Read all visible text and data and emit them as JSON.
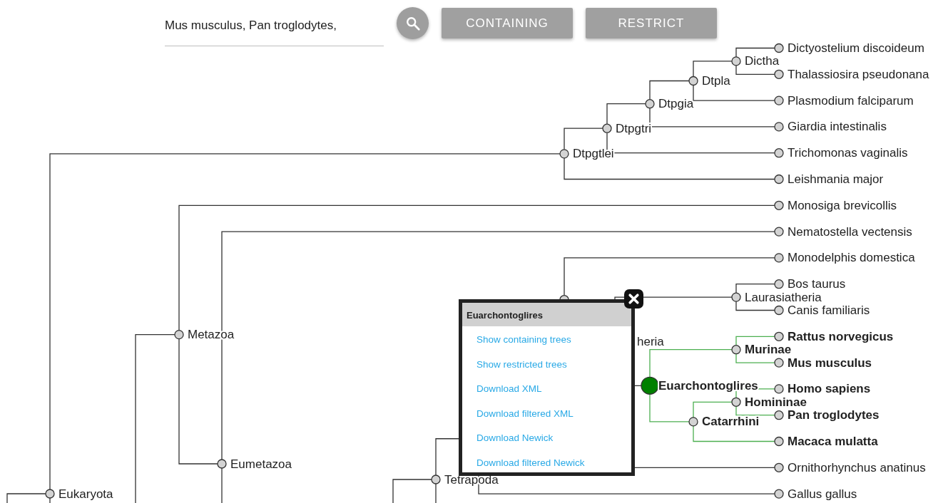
{
  "search": {
    "value": "Mus musculus, Pan troglodytes,"
  },
  "buttons": [
    "CONTAINING",
    "RESTRICT"
  ],
  "tree": [
    {
      "label": "Eukaryota",
      "selected": false,
      "children": [
        {
          "label": "Dtpgtlei",
          "selected": false,
          "children": [
            {
              "label": "Dtpgtri",
              "selected": false,
              "children": [
                {
                  "label": "Dtpgia",
                  "selected": false,
                  "children": [
                    {
                      "label": "Dtpla",
                      "selected": false,
                      "children": [
                        {
                          "label": "Dictha",
                          "selected": false,
                          "children": [
                            {
                              "label": "Dictyostelium discoideum",
                              "selected": false
                            },
                            {
                              "label": "Thalassiosira pseudonana",
                              "selected": false
                            }
                          ]
                        },
                        {
                          "label": "Plasmodium falciparum",
                          "selected": false
                        }
                      ]
                    },
                    {
                      "label": "Giardia intestinalis",
                      "selected": false
                    }
                  ]
                },
                {
                  "label": "Trichomonas vaginalis",
                  "selected": false
                }
              ]
            },
            {
              "label": "Leishmania major",
              "selected": false
            }
          ]
        }
      ]
    },
    {
      "label": "Metazoa",
      "selected": false,
      "children": [
        {
          "label": "Monosiga brevicollis",
          "selected": false
        },
        {
          "label": "Eumetazoa",
          "selected": false,
          "children": [
            {
              "label": "Nematostella vectensis",
              "selected": false
            }
          ]
        }
      ]
    },
    {
      "label": "Tetrapoda",
      "selected": false,
      "children": [
        {
          "children": [
            {
              "children": [
                {
                  "selected": false,
                  "children": [
                    {
                      "label": "Monodelphis domestica",
                      "selected": false
                    },
                    {
                      "label": "heria",
                      "selected": false,
                      "children": [
                        {
                          "label": "Laurasiatheria",
                          "selected": false,
                          "children": [
                            {
                              "label": "Bos taurus",
                              "selected": false
                            },
                            {
                              "label": "Canis familiaris",
                              "selected": false
                            }
                          ]
                        },
                        {
                          "label": "Euarchontoglires",
                          "selected": true,
                          "children": [
                            {
                              "label": "Murinae",
                              "selected": false,
                              "children": [
                                {
                                  "label": "Rattus norvegicus",
                                  "selected": false
                                },
                                {
                                  "label": "Mus musculus",
                                  "selected": false
                                }
                              ]
                            },
                            {
                              "label": "Catarrhini",
                              "selected": false,
                              "children": [
                                {
                                  "label": "Homininae",
                                  "selected": false,
                                  "children": [
                                    {
                                      "label": "Homo sapiens",
                                      "selected": false
                                    },
                                    {
                                      "label": "Pan troglodytes",
                                      "selected": false
                                    }
                                  ]
                                },
                                {
                                  "label": "Macaca mulatta",
                                  "selected": false
                                }
                              ]
                            }
                          ]
                        }
                      ]
                    }
                  ]
                },
                {
                  "label": "Ornithorhynchus anatinus",
                  "selected": false
                }
              ]
            },
            {
              "label": "Gallus gallus",
              "selected": false
            }
          ]
        }
      ]
    }
  ],
  "popup": {
    "title": "Euarchontoglires",
    "links": [
      "Show containing trees",
      "Show restricted trees",
      "Download XML",
      "Download filtered XML",
      "Download Newick",
      "Download filtered Newick"
    ]
  }
}
